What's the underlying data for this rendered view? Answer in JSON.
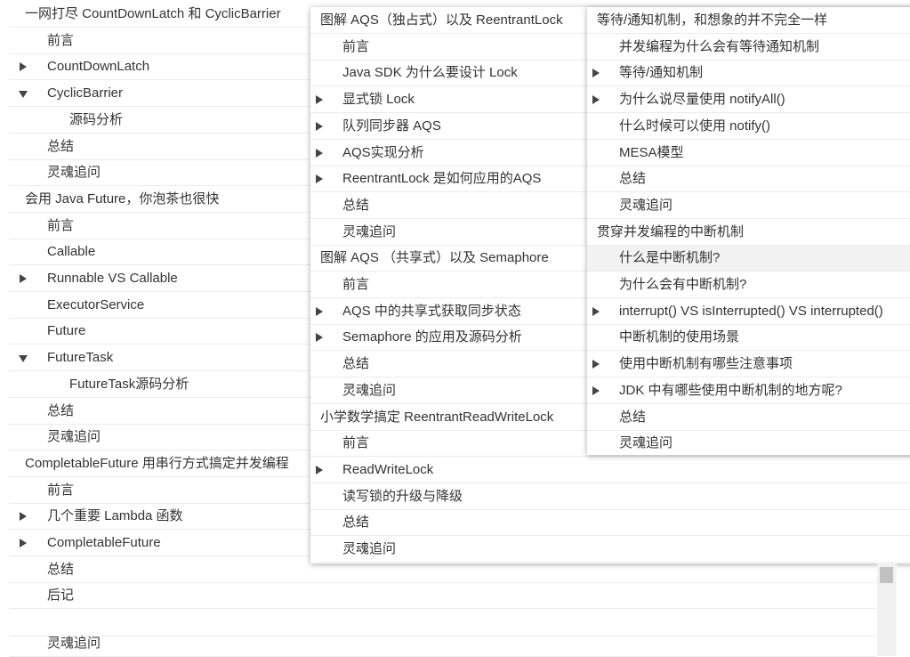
{
  "background_tree": [
    {
      "label": "一网打尽 CountDownLatch 和 CyclicBarrier",
      "level": 0
    },
    {
      "label": "前言",
      "level": 1
    },
    {
      "label": "CountDownLatch",
      "level": 1,
      "arrow": "collapsed"
    },
    {
      "label": "CyclicBarrier",
      "level": 1,
      "arrow": "expanded"
    },
    {
      "label": "源码分析",
      "level": 2
    },
    {
      "label": "总结",
      "level": 1
    },
    {
      "label": "灵魂追问",
      "level": 1
    },
    {
      "label": "会用 Java Future，你泡茶也很快",
      "level": 0
    },
    {
      "label": "前言",
      "level": 1
    },
    {
      "label": "Callable",
      "level": 1
    },
    {
      "label": "Runnable VS Callable",
      "level": 1,
      "arrow": "collapsed"
    },
    {
      "label": "ExecutorService",
      "level": 1
    },
    {
      "label": "Future",
      "level": 1
    },
    {
      "label": "FutureTask",
      "level": 1,
      "arrow": "expanded"
    },
    {
      "label": "FutureTask源码分析",
      "level": 2
    },
    {
      "label": "总结",
      "level": 1
    },
    {
      "label": "灵魂追问",
      "level": 1
    },
    {
      "label": "CompletableFuture 用串行方式搞定并发编程",
      "level": 0
    },
    {
      "label": "前言",
      "level": 1
    },
    {
      "label": "几个重要 Lambda 函数",
      "level": 1,
      "arrow": "collapsed"
    },
    {
      "label": "CompletableFuture",
      "level": 1,
      "arrow": "collapsed"
    },
    {
      "label": "总结",
      "level": 1
    },
    {
      "label": "后记",
      "level": 1
    },
    {
      "label": "",
      "level": 1
    },
    {
      "label": "灵魂追问",
      "level": 1
    }
  ],
  "middle_panel": [
    {
      "label": "图解 AQS（独占式）以及 ReentrantLock",
      "level": 0
    },
    {
      "label": "前言",
      "level": 1
    },
    {
      "label": "Java SDK 为什么要设计 Lock",
      "level": 1
    },
    {
      "label": "显式锁 Lock",
      "level": 1,
      "arrow": "collapsed"
    },
    {
      "label": "队列同步器 AQS",
      "level": 1,
      "arrow": "collapsed"
    },
    {
      "label": "AQS实现分析",
      "level": 1,
      "arrow": "collapsed"
    },
    {
      "label": "ReentrantLock 是如何应用的AQS",
      "level": 1,
      "arrow": "collapsed"
    },
    {
      "label": "总结",
      "level": 1
    },
    {
      "label": "灵魂追问",
      "level": 1
    },
    {
      "label": "图解 AQS （共享式）以及 Semaphore",
      "level": 0
    },
    {
      "label": "前言",
      "level": 1
    },
    {
      "label": "AQS 中的共享式获取同步状态",
      "level": 1,
      "arrow": "collapsed"
    },
    {
      "label": "Semaphore 的应用及源码分析",
      "level": 1,
      "arrow": "collapsed"
    },
    {
      "label": "总结",
      "level": 1
    },
    {
      "label": "灵魂追问",
      "level": 1
    },
    {
      "label": "小学数学搞定 ReentrantReadWriteLock",
      "level": 0
    },
    {
      "label": "前言",
      "level": 1
    },
    {
      "label": "ReadWriteLock",
      "level": 1,
      "arrow": "collapsed"
    },
    {
      "label": "读写锁的升级与降级",
      "level": 1
    },
    {
      "label": "总结",
      "level": 1
    },
    {
      "label": "灵魂追问",
      "level": 1
    }
  ],
  "right_panel": [
    {
      "label": "等待/通知机制，和想象的并不完全一样",
      "level": 0
    },
    {
      "label": "并发编程为什么会有等待通知机制",
      "level": 1
    },
    {
      "label": "等待/通知机制",
      "level": 1,
      "arrow": "collapsed"
    },
    {
      "label": "为什么说尽量使用 notifyAll()",
      "level": 1,
      "arrow": "collapsed"
    },
    {
      "label": "什么时候可以使用 notify()",
      "level": 1
    },
    {
      "label": "MESA模型",
      "level": 1
    },
    {
      "label": "总结",
      "level": 1
    },
    {
      "label": "灵魂追问",
      "level": 1
    },
    {
      "label": "贯穿并发编程的中断机制",
      "level": 0
    },
    {
      "label": "什么是中断机制?",
      "level": 1,
      "highlighted": true
    },
    {
      "label": "为什么会有中断机制?",
      "level": 1
    },
    {
      "label": "interrupt() VS isInterrupted() VS interrupted()",
      "level": 1,
      "arrow": "collapsed"
    },
    {
      "label": "中断机制的使用场景",
      "level": 1
    },
    {
      "label": "使用中断机制有哪些注意事项",
      "level": 1,
      "arrow": "collapsed"
    },
    {
      "label": "JDK 中有哪些使用中断机制的地方呢?",
      "level": 1,
      "arrow": "collapsed"
    },
    {
      "label": "总结",
      "level": 1
    },
    {
      "label": "灵魂追问",
      "level": 1
    }
  ]
}
